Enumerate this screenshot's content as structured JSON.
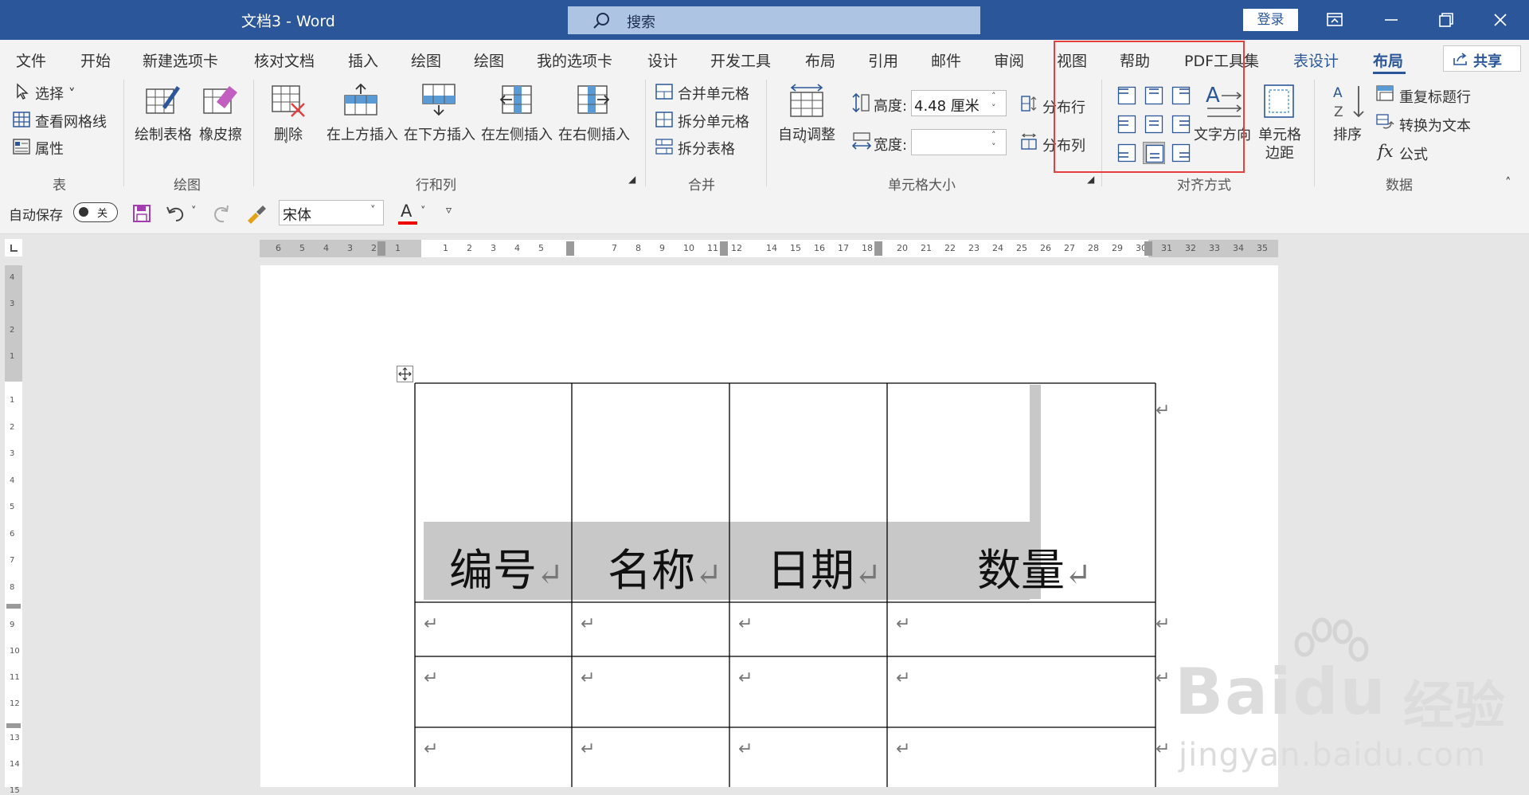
{
  "titlebar": {
    "title": "文档3  -  Word",
    "search_placeholder": "搜索",
    "login_label": "登录",
    "window_controls": [
      "ribbon-display-icon",
      "minimize-icon",
      "restore-icon",
      "close-icon"
    ]
  },
  "tabs": [
    {
      "label": "文件"
    },
    {
      "label": "开始"
    },
    {
      "label": "新建选项卡"
    },
    {
      "label": "核对文档"
    },
    {
      "label": "插入"
    },
    {
      "label": "绘图"
    },
    {
      "label": "绘图"
    },
    {
      "label": "我的选项卡"
    },
    {
      "label": "设计"
    },
    {
      "label": "开发工具"
    },
    {
      "label": "布局"
    },
    {
      "label": "引用"
    },
    {
      "label": "邮件"
    },
    {
      "label": "审阅"
    },
    {
      "label": "视图"
    },
    {
      "label": "帮助"
    },
    {
      "label": "PDF工具集"
    },
    {
      "label": "表设计"
    },
    {
      "label": "布局"
    }
  ],
  "share_label": "共享",
  "ribbon": {
    "table": {
      "select": "选择",
      "gridlines": "查看网格线",
      "properties": "属性",
      "group": "表"
    },
    "draw": {
      "draw_table": "绘制表格",
      "eraser": "橡皮擦",
      "group": "绘图"
    },
    "rows_cols": {
      "delete": "删除",
      "insert_above": "在上方插入",
      "insert_below": "在下方插入",
      "insert_left": "在左侧插入",
      "insert_right": "在右侧插入",
      "group": "行和列"
    },
    "merge": {
      "merge_cells": "合并单元格",
      "split_cells": "拆分单元格",
      "split_table": "拆分表格",
      "group": "合并"
    },
    "cell_size": {
      "autofit": "自动调整",
      "height_label": "高度:",
      "height_value": "4.48 厘米",
      "width_label": "宽度:",
      "width_value": "",
      "dist_rows": "分布行",
      "dist_cols": "分布列",
      "group": "单元格大小"
    },
    "alignment": {
      "text_direction": "文字方向",
      "cell_margins_1": "单元格",
      "cell_margins_2": "边距",
      "group": "对齐方式"
    },
    "data": {
      "sort": "排序",
      "repeat_header": "重复标题行",
      "convert_text": "转换为文本",
      "formula": "公式",
      "group": "数据"
    }
  },
  "qat": {
    "autosave_label": "自动保存",
    "autosave_state": "关",
    "font_name": "宋体"
  },
  "ruler": {
    "h_left": [
      "6",
      "5",
      "4",
      "3",
      "2",
      "1"
    ],
    "h_c1": [
      "1",
      "2",
      "3",
      "4",
      "5"
    ],
    "h_c2": [
      "7",
      "8",
      "9",
      "10",
      "11",
      "12"
    ],
    "h_c3": [
      "14",
      "15",
      "16",
      "17",
      "18"
    ],
    "h_c4": [
      "20",
      "21",
      "22",
      "23",
      "24",
      "25",
      "26",
      "27",
      "28",
      "29",
      "30"
    ],
    "h_right": [
      "31",
      "32",
      "33",
      "34",
      "35"
    ],
    "v_top": [
      "4",
      "3",
      "2",
      "1"
    ],
    "v_main": [
      "1",
      "2",
      "3",
      "4",
      "5",
      "6",
      "7",
      "8"
    ],
    "v_lower": [
      "9",
      "10",
      "11",
      "12"
    ],
    "v_bottom": [
      "13",
      "14",
      "15"
    ]
  },
  "table": {
    "headers": [
      "编号",
      "名称",
      "日期",
      "数量"
    ],
    "paragraph_mark": "↵"
  },
  "watermark": {
    "brand": "Baidu",
    "cn": "经验",
    "url": "jingyan.baidu.com"
  },
  "colors": {
    "accent": "#2b579a",
    "highlight_box": "#e34040",
    "header_fill": "#c8c8c8"
  }
}
